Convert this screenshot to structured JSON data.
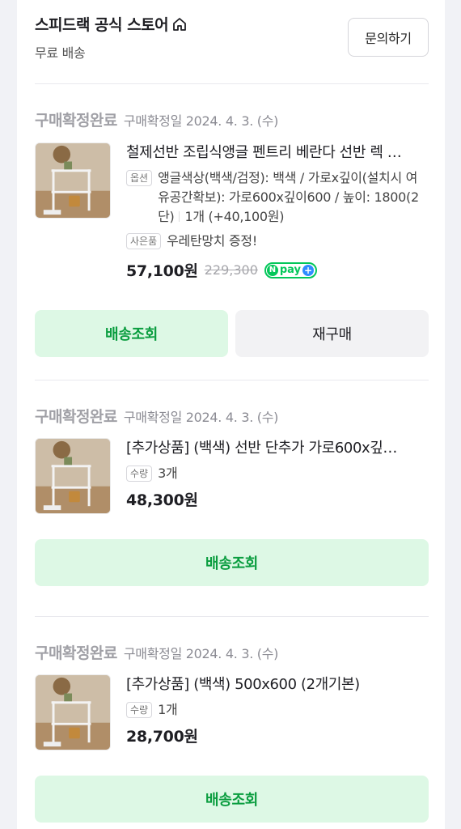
{
  "store": {
    "name": "스피드랙 공식 스토어",
    "home_icon": "home-icon",
    "shipping": "무료 배송",
    "inquiry_label": "문의하기"
  },
  "orders": [
    {
      "status": "구매확정완료",
      "confirm_date": "구매확정일 2024. 4. 3. (수)",
      "product_name": "철제선반 조립식앵글 펜트리 베란다 선반 렉 …",
      "option_tag": "옵션",
      "option_text": "앵글색상(백색/검정): 백색 / 가로x깊이(설치시 여유공간확보): 가로600x깊이600 / 높이: 1800(2단)",
      "option_qty": "1개 (+40,100원)",
      "gift_tag": "사은품",
      "gift_text": "우레탄망치 증정!",
      "price": "57,100원",
      "original_price": "229,300",
      "npay_label": "pay",
      "buttons": [
        "배송조회",
        "재구매"
      ]
    },
    {
      "status": "구매확정완료",
      "confirm_date": "구매확정일 2024. 4. 3. (수)",
      "product_name": "[추가상품] (백색) 선반 단추가 가로600x깊…",
      "qty_tag": "수량",
      "qty": "3개",
      "price": "48,300원",
      "buttons": [
        "배송조회"
      ]
    },
    {
      "status": "구매확정완료",
      "confirm_date": "구매확정일 2024. 4. 3. (수)",
      "product_name": "[추가상품] (백색) 500x600 (2개기본)",
      "qty_tag": "수량",
      "qty": "1개",
      "price": "28,700원",
      "buttons": [
        "배송조회"
      ]
    }
  ],
  "colors": {
    "accent_green": "#0a9d3f",
    "track_button_bg": "#ddf8e5",
    "npay_green": "#03c75a"
  }
}
